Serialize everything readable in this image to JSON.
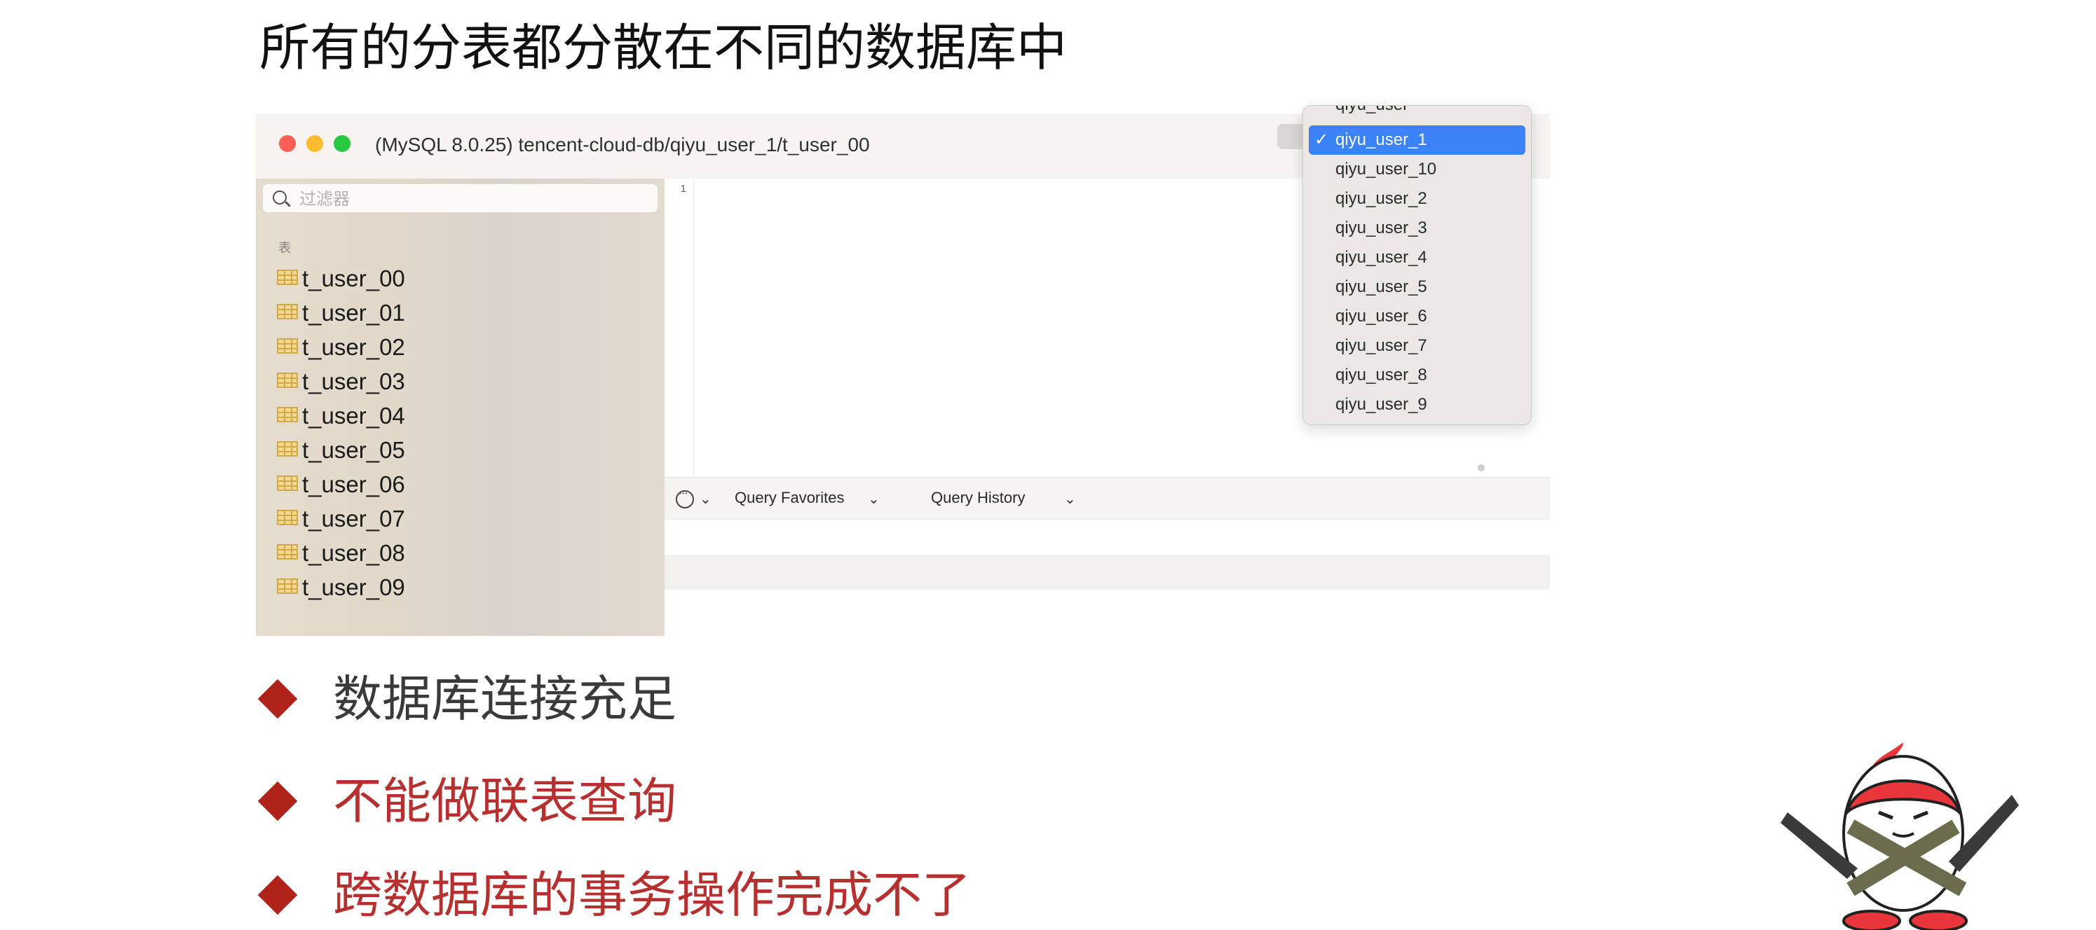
{
  "slide": {
    "title": "所有的分表都分散在不同的数据库中"
  },
  "window": {
    "title": "(MySQL 8.0.25) tencent-cloud-db/qiyu_user_1/t_user_00"
  },
  "sidebar": {
    "filter_placeholder": "过滤器",
    "section_label": "表",
    "tables": [
      "t_user_00",
      "t_user_01",
      "t_user_02",
      "t_user_03",
      "t_user_04",
      "t_user_05",
      "t_user_06",
      "t_user_07",
      "t_user_08",
      "t_user_09"
    ]
  },
  "editor": {
    "line_number": "1"
  },
  "query_bar": {
    "favorites_label": "Query Favorites",
    "history_label": "Query History"
  },
  "database_dropdown": {
    "partial_top_item": "qiyu_user",
    "selected": "qiyu_user_1",
    "items": [
      "qiyu_user_1",
      "qiyu_user_10",
      "qiyu_user_2",
      "qiyu_user_3",
      "qiyu_user_4",
      "qiyu_user_5",
      "qiyu_user_6",
      "qiyu_user_7",
      "qiyu_user_8",
      "qiyu_user_9"
    ]
  },
  "bullets": [
    {
      "text": "数据库连接充足",
      "color": "#3a3a3a"
    },
    {
      "text": "不能做联表查询",
      "color": "#b5302e"
    },
    {
      "text": "跨数据库的事务操作完成不了",
      "color": "#b5302e"
    }
  ],
  "colors": {
    "bullet_diamond": "#b02318",
    "selection_blue": "#3b82f6"
  }
}
